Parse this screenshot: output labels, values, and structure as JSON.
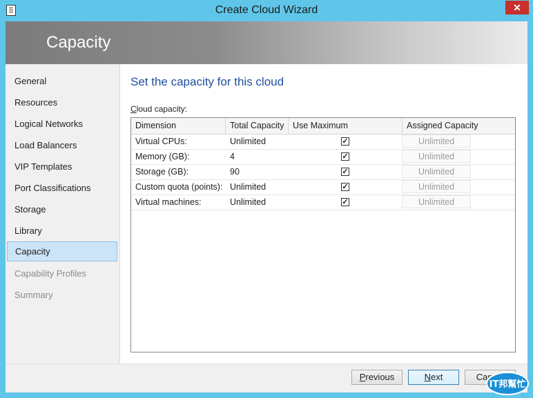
{
  "window": {
    "title": "Create Cloud Wizard",
    "close_glyph": "✕"
  },
  "banner": {
    "title": "Capacity"
  },
  "nav": {
    "items": [
      {
        "label": "General",
        "state": "normal"
      },
      {
        "label": "Resources",
        "state": "normal"
      },
      {
        "label": "Logical Networks",
        "state": "normal"
      },
      {
        "label": "Load Balancers",
        "state": "normal"
      },
      {
        "label": "VIP Templates",
        "state": "normal"
      },
      {
        "label": "Port Classifications",
        "state": "normal"
      },
      {
        "label": "Storage",
        "state": "normal"
      },
      {
        "label": "Library",
        "state": "normal"
      },
      {
        "label": "Capacity",
        "state": "selected"
      },
      {
        "label": "Capability Profiles",
        "state": "disabled"
      },
      {
        "label": "Summary",
        "state": "disabled"
      }
    ]
  },
  "main": {
    "heading": "Set the capacity for this cloud",
    "grid_label_first": "C",
    "grid_label_rest": "loud capacity:",
    "columns": [
      "Dimension",
      "Total Capacity",
      "Use Maximum",
      "Assigned Capacity"
    ],
    "rows": [
      {
        "dimension": "Virtual CPUs:",
        "total": "Unlimited",
        "use_max": true,
        "assigned": "Unlimited"
      },
      {
        "dimension": "Memory (GB):",
        "total": "4",
        "use_max": true,
        "assigned": "Unlimited"
      },
      {
        "dimension": "Storage (GB):",
        "total": "90",
        "use_max": true,
        "assigned": "Unlimited"
      },
      {
        "dimension": "Custom quota (points):",
        "total": "Unlimited",
        "use_max": true,
        "assigned": "Unlimited"
      },
      {
        "dimension": "Virtual machines:",
        "total": "Unlimited",
        "use_max": true,
        "assigned": "Unlimited"
      }
    ],
    "check_glyph": "✓"
  },
  "footer": {
    "previous_first": "P",
    "previous_rest": "revious",
    "next_first": "N",
    "next_rest": "ext",
    "cancel_label": "Cancel"
  },
  "watermark": {
    "text": "IT邦幫忙"
  },
  "colors": {
    "title_bar": "#5fc6ea",
    "heading": "#1f4e9e",
    "selected_nav": "#cce4f7",
    "close_button": "#c7302b"
  }
}
